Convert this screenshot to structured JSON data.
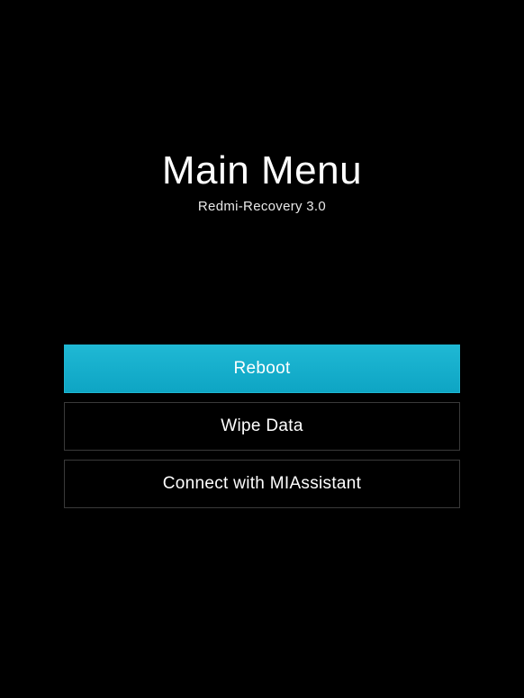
{
  "header": {
    "title": "Main Menu",
    "subtitle": "Redmi-Recovery 3.0"
  },
  "menu": {
    "items": [
      {
        "label": "Reboot",
        "selected": true
      },
      {
        "label": "Wipe Data",
        "selected": false
      },
      {
        "label": "Connect with MIAssistant",
        "selected": false
      }
    ]
  }
}
